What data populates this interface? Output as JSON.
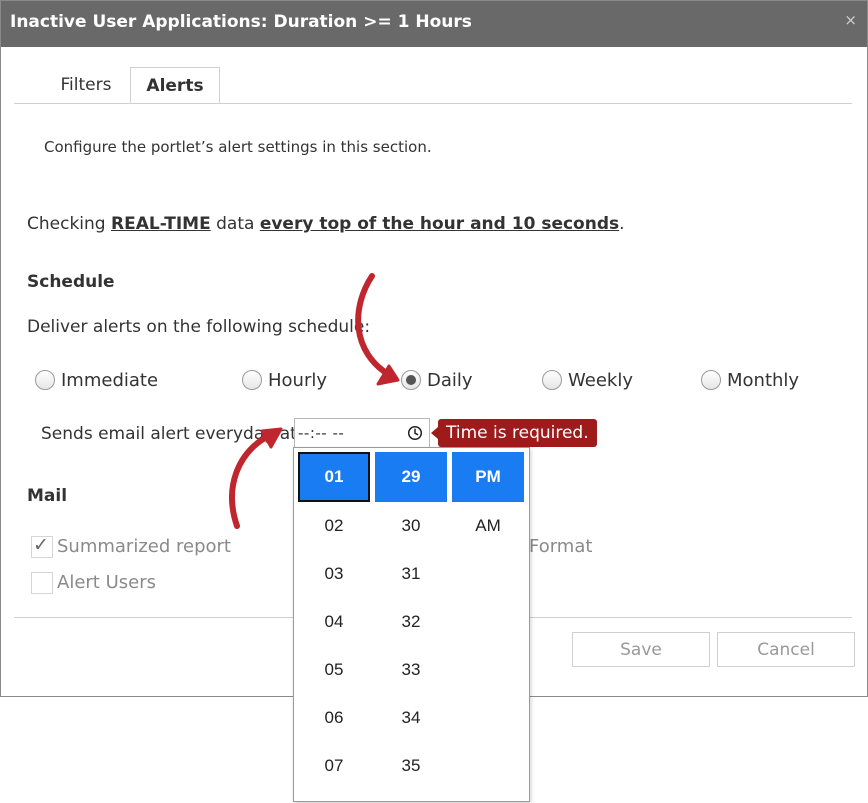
{
  "dialog": {
    "title": "Inactive User Applications: Duration >= 1 Hours",
    "close_glyph": "×"
  },
  "tabs": [
    {
      "label": "Filters",
      "active": false
    },
    {
      "label": "Alerts",
      "active": true
    }
  ],
  "alerts": {
    "description": "Configure the portlet’s alert settings in this section.",
    "checking_prefix": "Checking ",
    "checking_data": "REAL-TIME",
    "checking_mid": " data ",
    "checking_when": "every top of the hour and 10 seconds",
    "checking_suffix": "."
  },
  "schedule": {
    "heading": "Schedule",
    "deliver_label": "Deliver alerts on the following schedule:",
    "options": [
      {
        "label": "Immediate",
        "selected": false
      },
      {
        "label": "Hourly",
        "selected": false
      },
      {
        "label": "Daily",
        "selected": true
      },
      {
        "label": "Weekly",
        "selected": false
      },
      {
        "label": "Monthly",
        "selected": false
      }
    ],
    "sends_label": "Sends email alert everyday at",
    "time_value": "--:-- --",
    "time_error": "Time is required."
  },
  "time_picker": {
    "hours": [
      "01",
      "02",
      "03",
      "04",
      "05",
      "06",
      "07"
    ],
    "minutes": [
      "29",
      "30",
      "31",
      "32",
      "33",
      "34",
      "35"
    ],
    "periods": [
      "PM",
      "AM"
    ],
    "selected_hour": "01",
    "selected_minute": "29",
    "selected_period": "PM"
  },
  "mail": {
    "heading": "Mail",
    "summarized_label": "Summarized report",
    "summarized_checked": true,
    "alert_users_label": "Alert Users",
    "alert_users_checked": false,
    "format_fragment": "Format"
  },
  "footer": {
    "save_label": "Save",
    "cancel_label": "Cancel"
  },
  "colors": {
    "titlebar": "#696969",
    "picker_selected": "#1a7cf2",
    "error_tooltip": "#9e1b1b",
    "annotation_arrow": "#c0262e"
  }
}
